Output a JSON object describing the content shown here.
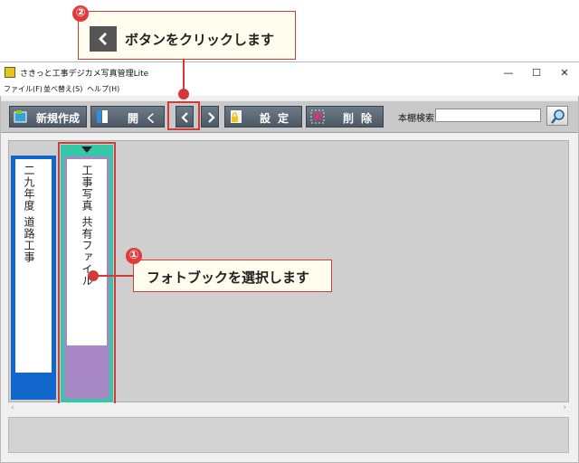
{
  "callouts": {
    "top": {
      "number": "②",
      "text": "ボタンをクリックします"
    },
    "bottom": {
      "number": "①",
      "text": "フォトブックを選択します"
    }
  },
  "window": {
    "title": "さきっと工事デジカメ写真管理Lite",
    "controls": {
      "minimize": "—",
      "maximize": "☐",
      "close": "✕"
    }
  },
  "menu": {
    "file": "ファイル(F)",
    "sort": "並べ替え(S)",
    "help": "ヘルプ(H)"
  },
  "toolbar": {
    "new_label": "新規作成",
    "open_label": "開く",
    "settings_label": "設定",
    "delete_label": "削除",
    "search_label": "本棚検索",
    "search_value": ""
  },
  "books": [
    {
      "title_line1": "二九年度",
      "title_line2": "道路工事",
      "color": "#1166cc"
    },
    {
      "title_line1": "工事写真",
      "title_line2": "共有ファイル",
      "color": "#a889c6",
      "selected": true
    }
  ],
  "colors": {
    "accent_red": "#d23a3a",
    "callout_bg": "#fffdee",
    "toolbar_button": "#5b6672",
    "selected_border": "#33c9a6"
  }
}
